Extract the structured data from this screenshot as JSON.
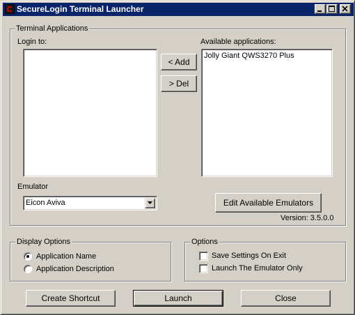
{
  "window": {
    "title": "SecureLogin Terminal Launcher",
    "title_bar_color": "#0a246a",
    "icons": {
      "app": "securelogin-app-icon",
      "minimize": "minimize-icon",
      "maximize": "maximize-icon",
      "close": "close-icon"
    }
  },
  "terminal_applications": {
    "group_label": "Terminal Applications",
    "login_to_label": "Login to:",
    "login_to_items": [],
    "available_label": "Available applications:",
    "available_items": [
      "Jolly Giant QWS3270 Plus"
    ],
    "add_button": "< Add",
    "del_button": "> Del",
    "emulator_label": "Emulator",
    "emulator_selected": "Eicon Aviva",
    "edit_emulators_button": "Edit Available Emulators",
    "version": "Version: 3.5.0.0"
  },
  "display_options": {
    "group_label": "Display Options",
    "options": [
      {
        "label": "Application Name",
        "selected": true
      },
      {
        "label": "Application Description",
        "selected": false
      }
    ]
  },
  "options": {
    "group_label": "Options",
    "checkboxes": [
      {
        "label": "Save Settings On Exit",
        "checked": false
      },
      {
        "label": "Launch The Emulator Only",
        "checked": false
      }
    ]
  },
  "footer": {
    "create_shortcut": "Create Shortcut",
    "launch": "Launch",
    "close": "Close"
  }
}
